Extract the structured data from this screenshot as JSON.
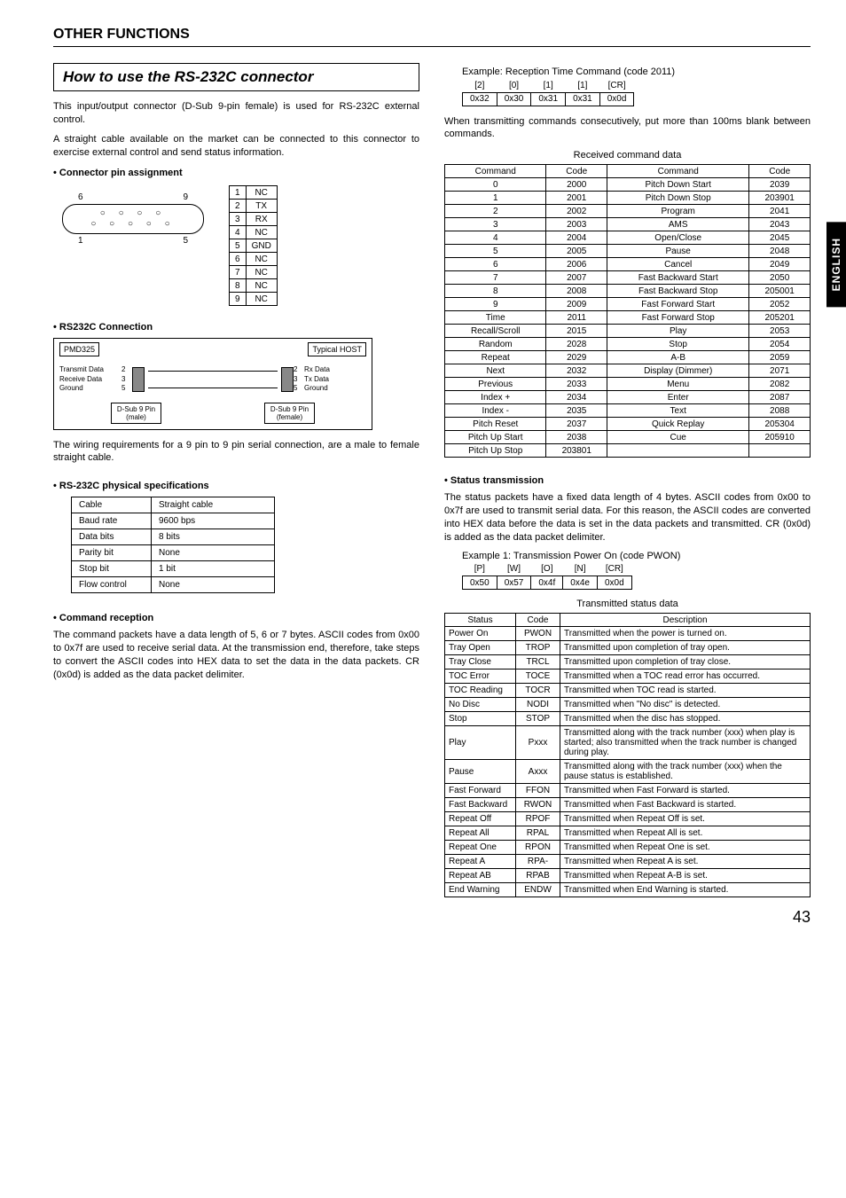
{
  "language_tab": "ENGLISH",
  "page_number": "43",
  "section_heading": "OTHER FUNCTIONS",
  "howto_title": "How to use the RS-232C connector",
  "intro_p1": "This input/output connector (D-Sub 9-pin female) is used for RS-232C external control.",
  "intro_p2": "A straight cable available on the market can be connected to this connector to exercise external control and send status information.",
  "bullet_pin": "Connector pin assignment",
  "pin_labels": {
    "top_left": "6",
    "top_right": "9",
    "bot_left": "1",
    "bot_right": "5"
  },
  "pin_table": [
    [
      "1",
      "NC"
    ],
    [
      "2",
      "TX"
    ],
    [
      "3",
      "RX"
    ],
    [
      "4",
      "NC"
    ],
    [
      "5",
      "GND"
    ],
    [
      "6",
      "NC"
    ],
    [
      "7",
      "NC"
    ],
    [
      "8",
      "NC"
    ],
    [
      "9",
      "NC"
    ]
  ],
  "bullet_conn": "RS232C Connection",
  "diag": {
    "left_box": "PMD325",
    "right_box": "Typical HOST",
    "left_sig1": "Transmit Data",
    "left_sig2": "Receive Data",
    "left_sig3": "Ground",
    "left_n1": "2",
    "left_n2": "3",
    "left_n3": "5",
    "right_n1": "2",
    "right_n2": "3",
    "right_n3": "5",
    "right_sig1": "Rx Data",
    "right_sig2": "Tx Data",
    "right_sig3": "Ground",
    "dsub_left": "D-Sub 9 Pin\n(male)",
    "dsub_right": "D-Sub 9 Pin\n(female)"
  },
  "wiring_p": "The wiring requirements for a 9 pin to 9 pin serial connection, are a male to female straight cable.",
  "bullet_spec": "RS-232C physical specifications",
  "spec_table": [
    [
      "Cable",
      "Straight cable"
    ],
    [
      "Baud rate",
      "9600 bps"
    ],
    [
      "Data bits",
      "8 bits"
    ],
    [
      "Parity bit",
      "None"
    ],
    [
      "Stop bit",
      "1 bit"
    ],
    [
      "Flow control",
      "None"
    ]
  ],
  "bullet_cmdrx": "Command reception",
  "cmdrx_p": "The command packets have a data length of 5, 6 or 7 bytes. ASCII codes from 0x00 to 0x7f are used to receive serial data. At the transmission end, therefore, take steps to convert the ASCII codes into HEX data to set the data in the data packets. CR (0x0d) is added as the data packet delimiter.",
  "ex1_caption": "Example: Reception Time Command (code 2011)",
  "ex1_row1": [
    "[2]",
    "[0]",
    "[1]",
    "[1]",
    "[CR]"
  ],
  "ex1_row2": [
    "0x32",
    "0x30",
    "0x31",
    "0x31",
    "0x0d"
  ],
  "consec_p": "When transmitting commands consecutively, put more than 100ms blank between commands.",
  "rx_caption": "Received command data",
  "rx_headers": [
    "Command",
    "Code",
    "Command",
    "Code"
  ],
  "rx_rows": [
    [
      "0",
      "2000",
      "Pitch Down Start",
      "2039"
    ],
    [
      "1",
      "2001",
      "Pitch Down Stop",
      "203901"
    ],
    [
      "2",
      "2002",
      "Program",
      "2041"
    ],
    [
      "3",
      "2003",
      "AMS",
      "2043"
    ],
    [
      "4",
      "2004",
      "Open/Close",
      "2045"
    ],
    [
      "5",
      "2005",
      "Pause",
      "2048"
    ],
    [
      "6",
      "2006",
      "Cancel",
      "2049"
    ],
    [
      "7",
      "2007",
      "Fast Backward Start",
      "2050"
    ],
    [
      "8",
      "2008",
      "Fast Backward Stop",
      "205001"
    ],
    [
      "9",
      "2009",
      "Fast Forward Start",
      "2052"
    ],
    [
      "Time",
      "2011",
      "Fast Forward Stop",
      "205201"
    ],
    [
      "Recall/Scroll",
      "2015",
      "Play",
      "2053"
    ],
    [
      "Random",
      "2028",
      "Stop",
      "2054"
    ],
    [
      "Repeat",
      "2029",
      "A-B",
      "2059"
    ],
    [
      "Next",
      "2032",
      "Display (Dimmer)",
      "2071"
    ],
    [
      "Previous",
      "2033",
      "Menu",
      "2082"
    ],
    [
      "Index +",
      "2034",
      "Enter",
      "2087"
    ],
    [
      "Index -",
      "2035",
      "Text",
      "2088"
    ],
    [
      "Pitch Reset",
      "2037",
      "Quick Replay",
      "205304"
    ],
    [
      "Pitch Up Start",
      "2038",
      "Cue",
      "205910"
    ],
    [
      "Pitch Up Stop",
      "203801",
      "",
      ""
    ]
  ],
  "bullet_status": "Status transmission",
  "status_p": "The status packets have a fixed data length of 4 bytes. ASCII codes from 0x00 to 0x7f are used to transmit serial data.  For this reason, the ASCII codes are converted into HEX data before the data is set in the data packets and transmitted.  CR (0x0d) is added as the data packet delimiter.",
  "ex2_caption": "Example 1: Transmission Power On (code PWON)",
  "ex2_row1": [
    "[P]",
    "[W]",
    "[O]",
    "[N]",
    "[CR]"
  ],
  "ex2_row2": [
    "0x50",
    "0x57",
    "0x4f",
    "0x4e",
    "0x0d"
  ],
  "tx_caption": "Transmitted status data",
  "tx_headers": [
    "Status",
    "Code",
    "Description"
  ],
  "tx_rows": [
    [
      "Power On",
      "PWON",
      "Transmitted when the power is turned on."
    ],
    [
      "Tray Open",
      "TROP",
      "Transmitted upon completion of tray open."
    ],
    [
      "Tray Close",
      "TRCL",
      "Transmitted upon completion of tray close."
    ],
    [
      "TOC Error",
      "TOCE",
      "Transmitted when a TOC read error has occurred."
    ],
    [
      "TOC Reading",
      "TOCR",
      "Transmitted when TOC read is started."
    ],
    [
      "No Disc",
      "NODI",
      "Transmitted when \"No disc\" is detected."
    ],
    [
      "Stop",
      "STOP",
      "Transmitted when the disc has stopped."
    ],
    [
      "Play",
      "Pxxx",
      "Transmitted along with the track number (xxx) when play is started; also transmitted when the track number is changed during play."
    ],
    [
      "Pause",
      "Axxx",
      "Transmitted along with the track number (xxx) when the pause status is established."
    ],
    [
      "Fast Forward",
      "FFON",
      "Transmitted when Fast Forward is started."
    ],
    [
      "Fast Backward",
      "RWON",
      "Transmitted when Fast Backward is started."
    ],
    [
      "Repeat Off",
      "RPOF",
      "Transmitted when Repeat Off is set."
    ],
    [
      "Repeat All",
      "RPAL",
      "Transmitted when Repeat All is set."
    ],
    [
      "Repeat One",
      "RPON",
      "Transmitted when Repeat One is set."
    ],
    [
      "Repeat A",
      "RPA-",
      "Transmitted when Repeat A is set."
    ],
    [
      "Repeat AB",
      "RPAB",
      "Transmitted when Repeat A-B is set."
    ],
    [
      "End Warning",
      "ENDW",
      "Transmitted when End Warning is started."
    ]
  ]
}
